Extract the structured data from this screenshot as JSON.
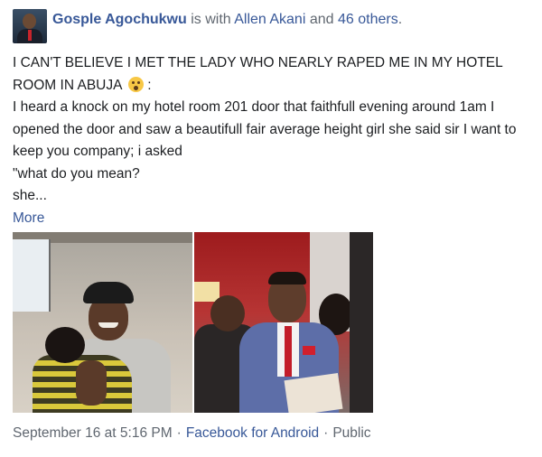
{
  "post": {
    "author": "Gosple Agochukwu",
    "with_text": "is with",
    "tagged": "Allen Akani",
    "and_text": "and",
    "others": "46 others",
    "period": ".",
    "headline_text": "I CAN'T BELIEVE I MET THE LADY WHO NEARLY RAPED ME IN MY HOTEL ROOM IN ABUJA",
    "headline_emoji": "shocked-face-icon",
    "headline_suffix": ":",
    "body_lines": [
      "I heard a knock on my hotel room 201 door that faithfull evening around 1am I opened the door and saw a beautifull fair average height girl she said sir I want to keep you company; i asked",
      "\"what do you mean?",
      "she..."
    ],
    "more_label": "More",
    "date": "September 16 at 5:16 PM",
    "app": "Facebook for Android",
    "privacy": "Public",
    "separator": "·"
  },
  "colors": {
    "link": "#385898",
    "muted": "#606770",
    "text": "#1c1e21"
  }
}
